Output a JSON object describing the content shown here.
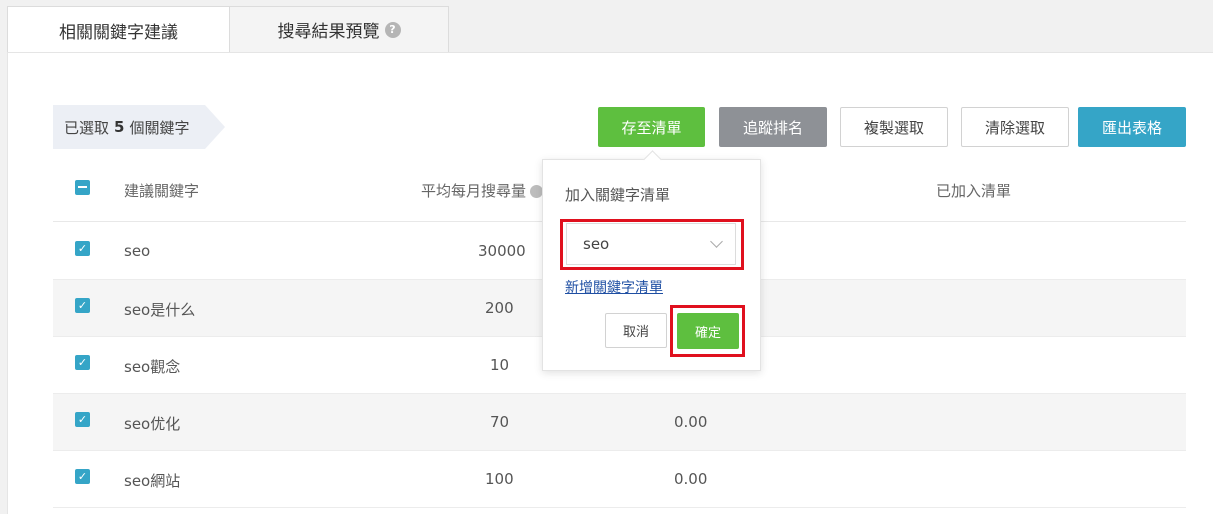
{
  "tabs": [
    {
      "label": "相關關鍵字建議",
      "active": true
    },
    {
      "label": "搜尋結果預覽",
      "active": false
    }
  ],
  "help_glyph": "?",
  "selection": {
    "prefix": "已選取",
    "count": "5",
    "suffix": "個關鍵字"
  },
  "toolbar": {
    "save": "存至清單",
    "track": "追蹤排名",
    "copy": "複製選取",
    "clear": "清除選取",
    "export": "匯出表格"
  },
  "table": {
    "headers": {
      "keyword": "建議關鍵字",
      "volume": "平均每月搜尋量",
      "added": "已加入清單"
    },
    "rows": [
      {
        "keyword": "seo",
        "volume": "30000",
        "cpc": ""
      },
      {
        "keyword": "seo是什么",
        "volume": "200",
        "cpc": ""
      },
      {
        "keyword": "seo觀念",
        "volume": "10",
        "cpc": ""
      },
      {
        "keyword": "seo优化",
        "volume": "70",
        "cpc": "0.00"
      },
      {
        "keyword": "seo網站",
        "volume": "100",
        "cpc": "0.00"
      }
    ]
  },
  "popup": {
    "title": "加入關鍵字清單",
    "selected_list": "seo",
    "new_list_link": "新增關鍵字清單",
    "cancel": "取消",
    "confirm": "確定"
  },
  "colors": {
    "green": "#5ebf3f",
    "blue": "#35a5c7",
    "gray": "#8e9196",
    "highlight_red": "#e0101e"
  }
}
